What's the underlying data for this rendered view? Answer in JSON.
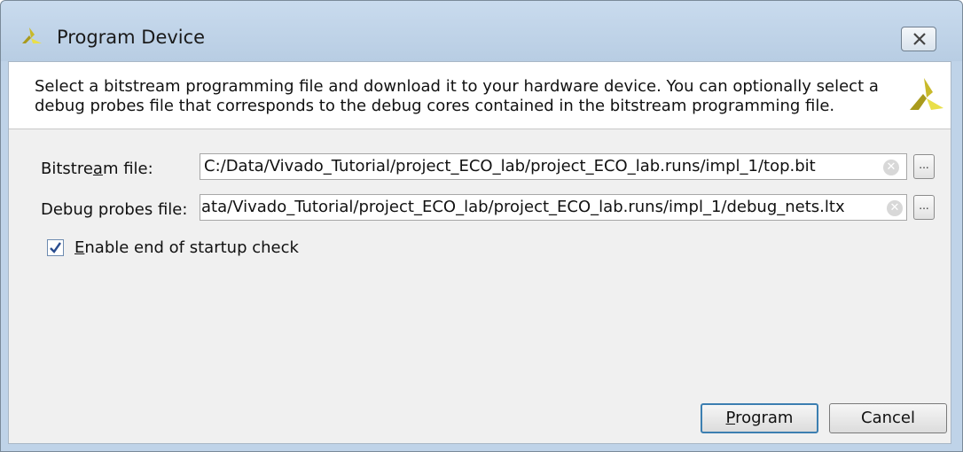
{
  "window": {
    "title": "Program Device"
  },
  "header": {
    "description": "Select a bitstream programming file and download it to your hardware device. You can optionally select a debug probes file that corresponds to the debug cores contained in the bitstream programming file."
  },
  "fields": {
    "bitstream": {
      "label_pre": "Bitstre",
      "label_mnemonic": "a",
      "label_post": "m file:",
      "value": "C:/Data/Vivado_Tutorial/project_ECO_lab/project_ECO_lab.runs/impl_1/top.bit",
      "browse": "..."
    },
    "debug_probes": {
      "label": "Debug probes file:",
      "value": ")ata/Vivado_Tutorial/project_ECO_lab/project_ECO_lab.runs/impl_1/debug_nets.ltx",
      "browse": "..."
    }
  },
  "options": {
    "startup_check": {
      "mnemonic": "E",
      "label_rest": "nable end of startup check",
      "checked": true
    }
  },
  "buttons": {
    "program": {
      "mnemonic": "P",
      "rest": "rogram"
    },
    "cancel": "Cancel"
  },
  "icons": {
    "app_logo": "xilinx-logo-icon",
    "close": "close-icon",
    "clear": "clear-field-icon",
    "check": "checkmark-icon"
  },
  "colors": {
    "logo_dark": "#a99a1c",
    "logo_light": "#e9df4a",
    "primary_border": "#3c7fb1",
    "titlebar": "#bfd3e8"
  }
}
